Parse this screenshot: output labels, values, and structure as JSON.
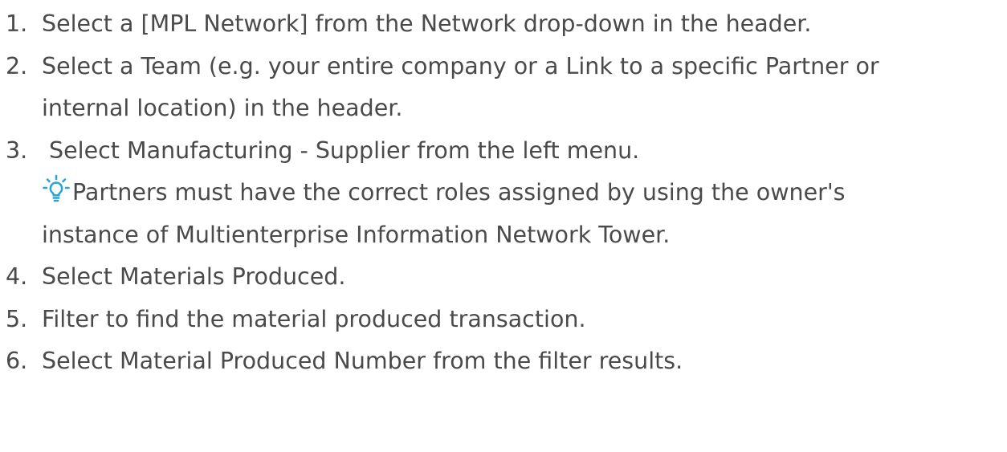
{
  "steps": [
    {
      "number": "1.",
      "lines": [
        "Select a [MPL Network] from the Network drop-down in the header."
      ]
    },
    {
      "number": "2.",
      "lines": [
        "Select a Team (e.g. your entire company or a Link to a specific Partner or",
        "internal location) in the header."
      ]
    },
    {
      "number": "3.",
      "lines": [
        " Select Manufacturing - Supplier from the left menu."
      ],
      "tip": {
        "icon": "lightbulb-tip-icon",
        "lines": [
          "Partners must have the correct roles assigned by using the owner's",
          "instance of Multienterprise Information Network Tower."
        ]
      }
    },
    {
      "number": "4.",
      "lines": [
        "Select Materials Produced."
      ]
    },
    {
      "number": "5.",
      "lines": [
        "Filter to find the material produced transaction."
      ]
    },
    {
      "number": "6.",
      "lines": [
        "Select Material Produced Number from the filter results."
      ]
    }
  ],
  "colors": {
    "text": "#4a4a4a",
    "tip_icon": "#2aa4d8"
  }
}
